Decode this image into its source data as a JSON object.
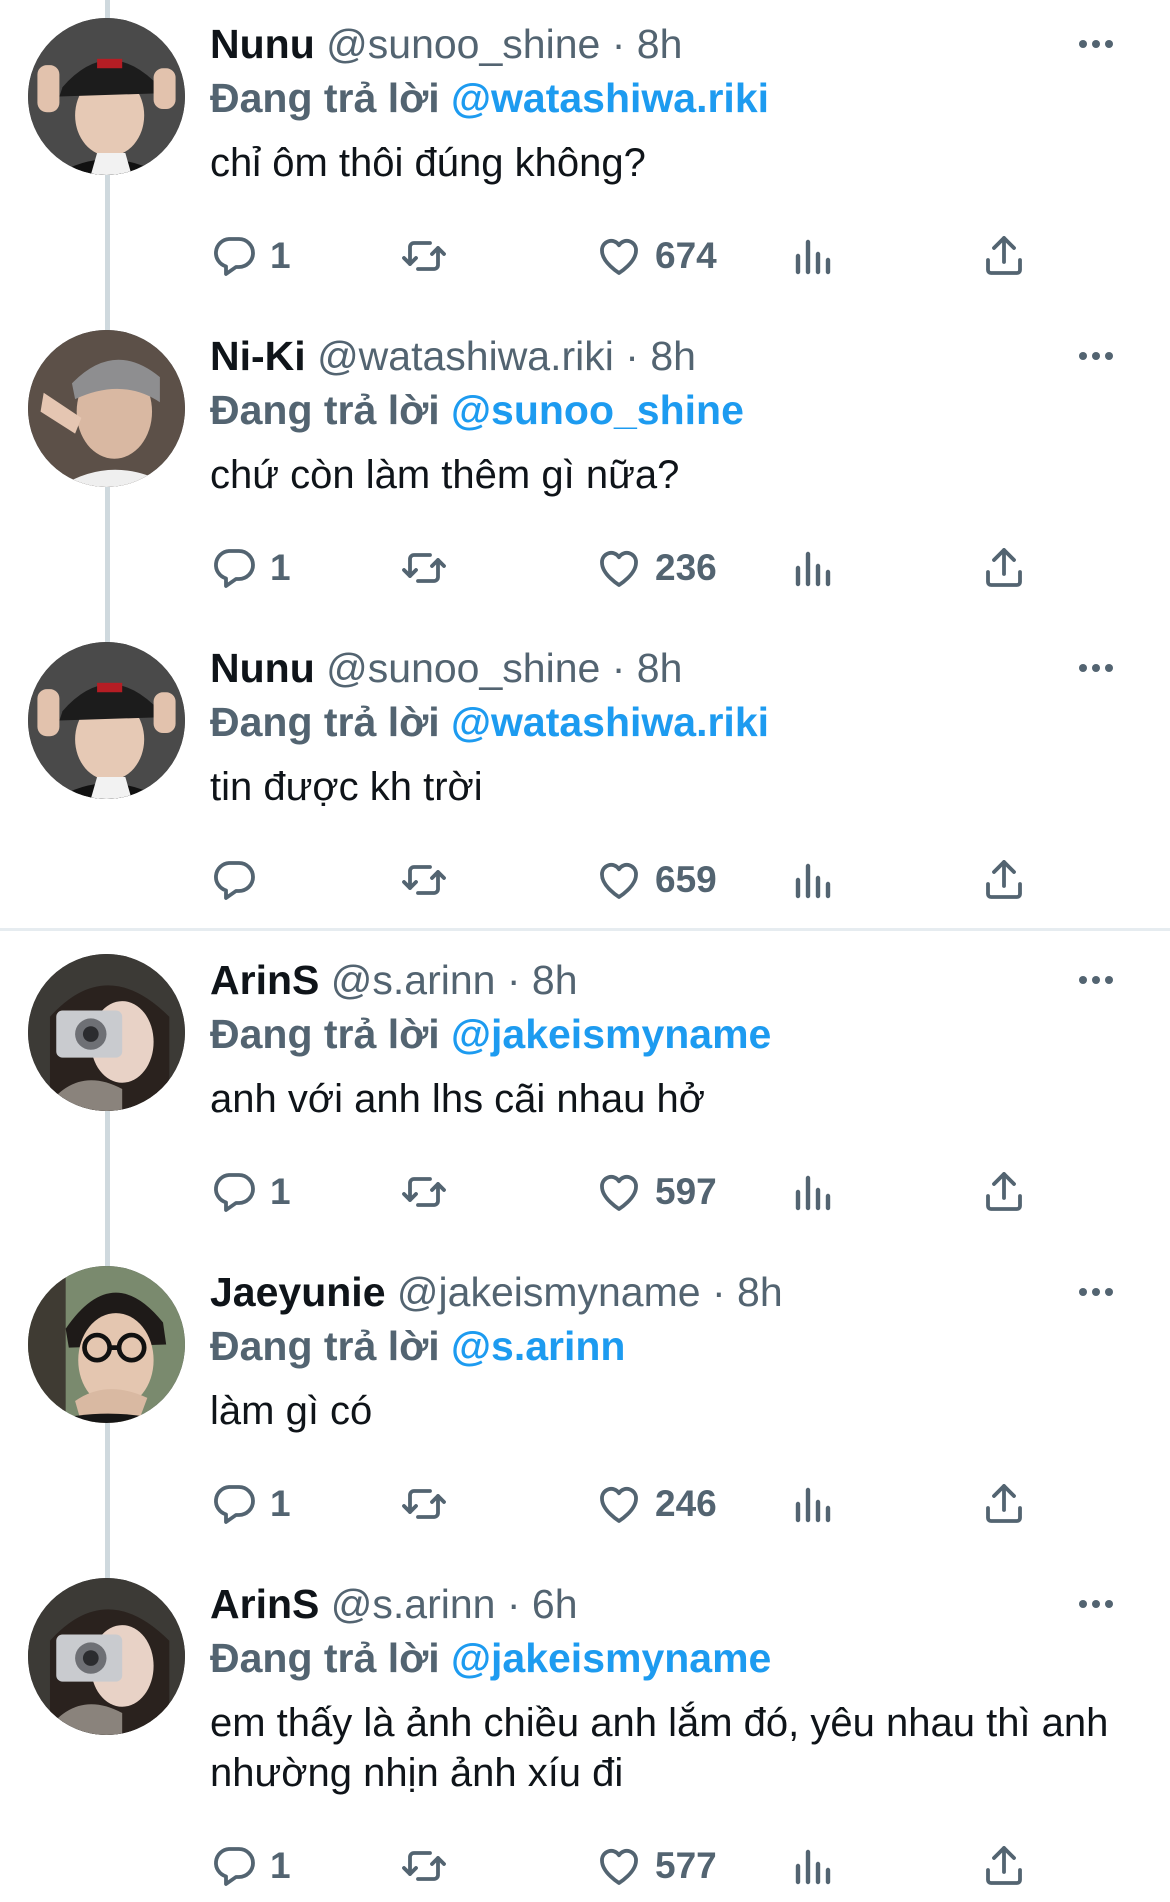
{
  "reply_prefix": "Đang trả lời",
  "colors": {
    "link": "#1d9bf0",
    "secondary": "#536471",
    "text": "#0f1419"
  },
  "icons": {
    "reply": "speech-bubble-icon",
    "retweet": "retweet-arrows-icon",
    "like": "heart-icon",
    "views": "bar-chart-icon",
    "share": "upload-arrow-icon",
    "more": "ellipsis-icon"
  },
  "tweets": [
    {
      "name": "Nunu",
      "handle": "@sunoo_shine",
      "sep": "·",
      "time": "8h",
      "reply_to": "@watashiwa.riki",
      "text": "chỉ ôm thôi đúng không?",
      "replies": "1",
      "likes": "674",
      "avatar": "nunu"
    },
    {
      "name": "Ni-Ki",
      "handle": "@watashiwa.riki",
      "sep": "·",
      "time": "8h",
      "reply_to": "@sunoo_shine",
      "text": "chứ còn làm thêm gì nữa?",
      "replies": "1",
      "likes": "236",
      "avatar": "niki"
    },
    {
      "name": "Nunu",
      "handle": "@sunoo_shine",
      "sep": "·",
      "time": "8h",
      "reply_to": "@watashiwa.riki",
      "text": "tin được kh trời",
      "replies": "",
      "likes": "659",
      "avatar": "nunu"
    },
    {
      "name": "ArinS",
      "handle": "@s.arinn",
      "sep": "·",
      "time": "8h",
      "reply_to": "@jakeismyname",
      "text": "anh với anh lhs cãi nhau hở",
      "replies": "1",
      "likes": "597",
      "avatar": "arins"
    },
    {
      "name": "Jaeyunie",
      "handle": "@jakeismyname",
      "sep": "·",
      "time": "8h",
      "reply_to": "@s.arinn",
      "text": "làm gì có",
      "replies": "1",
      "likes": "246",
      "avatar": "jaeyunie"
    },
    {
      "name": "ArinS",
      "handle": "@s.arinn",
      "sep": "·",
      "time": "6h",
      "reply_to": "@jakeismyname",
      "text": "em thấy là ảnh chiều anh lắm đó, yêu nhau thì anh nhường nhịn ảnh xíu đi",
      "replies": "1",
      "likes": "577",
      "avatar": "arins"
    }
  ]
}
